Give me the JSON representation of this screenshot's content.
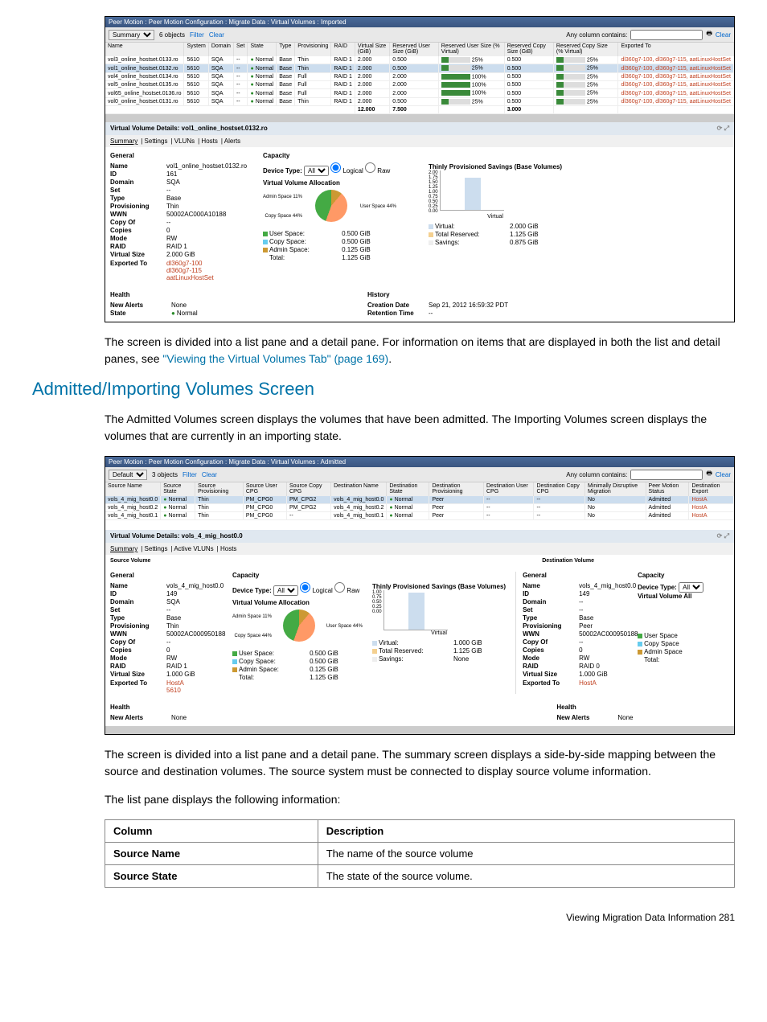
{
  "sshot1": {
    "title": "Peer Motion : Peer Motion Configuration : Migrate Data : Virtual Volumes : Imported",
    "toolbar": {
      "view": "Summary",
      "count": "6 objects",
      "filter": "Filter",
      "clear": "Clear",
      "anycol": "Any column contains:",
      "clear2": "Clear"
    },
    "headers": [
      "Name",
      "System",
      "Domain",
      "Set",
      "State",
      "Type",
      "Provisioning",
      "RAID",
      "Virtual Size (GiB)",
      "Reserved User Size (GiB)",
      "Reserved User Size (% Virtual)",
      "Reserved Copy Size (GiB)",
      "Reserved Copy Size (% Virtual)",
      "Exported To"
    ],
    "rows": [
      {
        "name": "vol3_online_hostset.0133.ro",
        "sys": "5610",
        "dom": "SQA",
        "set": "--",
        "state": "Normal",
        "type": "Base",
        "prov": "Thin",
        "raid": "RAID 1",
        "vsz": "2.000",
        "rusz": "0.500",
        "rupct": "25%",
        "rcsz": "0.500",
        "rcpct": "25%",
        "exp": "dl360g7-100, dl360g7-115, aatLinuxHostSet"
      },
      {
        "name": "vol1_online_hostset.0132.ro",
        "sys": "5610",
        "dom": "SQA",
        "set": "--",
        "state": "Normal",
        "type": "Base",
        "prov": "Thin",
        "raid": "RAID 1",
        "vsz": "2.000",
        "rusz": "0.500",
        "rupct": "25%",
        "rcsz": "0.500",
        "rcpct": "25%",
        "exp": "dl360g7-100, dl360g7-115, aatLinuxHostSet",
        "sel": true
      },
      {
        "name": "vol4_online_hostset.0134.ro",
        "sys": "5610",
        "dom": "SQA",
        "set": "--",
        "state": "Normal",
        "type": "Base",
        "prov": "Full",
        "raid": "RAID 1",
        "vsz": "2.000",
        "rusz": "2.000",
        "rupct": "100%",
        "rcsz": "0.500",
        "rcpct": "25%",
        "exp": "dl360g7-100, dl360g7-115, aatLinuxHostSet"
      },
      {
        "name": "vol5_online_hostset.0135.ro",
        "sys": "5610",
        "dom": "SQA",
        "set": "--",
        "state": "Normal",
        "type": "Base",
        "prov": "Full",
        "raid": "RAID 1",
        "vsz": "2.000",
        "rusz": "2.000",
        "rupct": "100%",
        "rcsz": "0.500",
        "rcpct": "25%",
        "exp": "dl360g7-100, dl360g7-115, aatLinuxHostSet"
      },
      {
        "name": "vol65_online_hostset.0136.ro",
        "sys": "5610",
        "dom": "SQA",
        "set": "--",
        "state": "Normal",
        "type": "Base",
        "prov": "Full",
        "raid": "RAID 1",
        "vsz": "2.000",
        "rusz": "2.000",
        "rupct": "100%",
        "rcsz": "0.500",
        "rcpct": "25%",
        "exp": "dl360g7-100, dl360g7-115, aatLinuxHostSet"
      },
      {
        "name": "vol0_online_hostset.0131.ro",
        "sys": "5610",
        "dom": "SQA",
        "set": "--",
        "state": "Normal",
        "type": "Base",
        "prov": "Thin",
        "raid": "RAID 1",
        "vsz": "2.000",
        "rusz": "0.500",
        "rupct": "25%",
        "rcsz": "0.500",
        "rcpct": "25%",
        "exp": "dl360g7-100, dl360g7-115, aatLinuxHostSet"
      }
    ],
    "totals": {
      "vsz": "12.000",
      "rusz": "7.500",
      "rcsz": "3.000"
    },
    "detail_title": "Virtual Volume Details: vol1_online_hostset.0132.ro",
    "tabs": [
      "Summary",
      "Settings",
      "VLUNs",
      "Hosts",
      "Alerts"
    ],
    "general": "General",
    "capacity": "Capacity",
    "props": {
      "Name": "vol1_online_hostset.0132.ro",
      "ID": "161",
      "Domain": "SQA",
      "Set": "--",
      "Type": "Base",
      "Provisioning": "Thin",
      "WWN": "50002AC000A10188",
      "Copy Of": "--",
      "Copies": "0",
      "Mode": "RW",
      "RAID": "RAID 1",
      "Virtual Size": "2.000 GiB"
    },
    "exported_label": "Exported To",
    "exported": [
      "dl360g7-100",
      "dl360g7-115",
      "aatLinuxHostSet"
    ],
    "devtype": "Device Type:",
    "all": "All",
    "logical": "Logical",
    "raw": "Raw",
    "vva": "Virtual Volume Allocation",
    "pie_labels": {
      "admin": "Admin Space 11%",
      "user": "User Space 44%",
      "copy": "Copy Space 44%"
    },
    "legend1": [
      [
        "User Space:",
        "0.500 GiB"
      ],
      [
        "Copy Space:",
        "0.500 GiB"
      ],
      [
        "Admin Space:",
        "0.125 GiB"
      ],
      [
        "Total:",
        "1.125 GiB"
      ]
    ],
    "tp": "Thinly Provisioned Savings (Base Volumes)",
    "yticks": [
      "2.00",
      "1.75",
      "1.50",
      "1.25",
      "1.00",
      "0.75",
      "0.50",
      "0.25",
      "0.00"
    ],
    "xcat": "Virtual",
    "legend2": [
      [
        "Virtual:",
        "2.000 GiB"
      ],
      [
        "Total Reserved:",
        "1.125 GiB"
      ],
      [
        "Savings:",
        "0.875 GiB"
      ]
    ],
    "health": "Health",
    "history": "History",
    "alerts": {
      "New Alerts": "None",
      "State": "Normal"
    },
    "hist": {
      "Creation Date": "Sep 21, 2012 16:59:32 PDT",
      "Retention Time": "--"
    }
  },
  "body1_a": "The screen is divided into a list pane and a detail pane. For information on items that are displayed in both the list and detail panes, see ",
  "body1_link": "\"Viewing the Virtual Volumes Tab\" (page 169)",
  "body1_b": ".",
  "h2": "Admitted/Importing Volumes Screen",
  "body2": "The Admitted Volumes screen displays the volumes that have been admitted. The Importing Volumes screen displays the volumes that are currently in an importing state.",
  "sshot2": {
    "title": "Peer Motion : Peer Motion Configuration : Migrate Data : Virtual Volumes : Admitted",
    "toolbar": {
      "view": "Default",
      "count": "3 objects",
      "filter": "Filter",
      "clear": "Clear",
      "anycol": "Any column contains:",
      "clear2": "Clear"
    },
    "headers": [
      "Source Name",
      "Source State",
      "Source Provisioning",
      "Source User CPG",
      "Source Copy CPG",
      "Destination Name",
      "Destination State",
      "Destination Provisioning",
      "Destination User CPG",
      "Destination Copy CPG",
      "Minimally Disruptive Migration",
      "Peer Motion Status",
      "Destination Export"
    ],
    "rows": [
      {
        "sn": "vols_4_mig_host0.0",
        "ss": "Normal",
        "sp": "Thin",
        "suc": "PM_CPG0",
        "scc": "PM_CPG2",
        "dn": "vols_4_mig_host0.0",
        "ds": "Normal",
        "dp": "Peer",
        "duc": "--",
        "dcc": "--",
        "mdm": "No",
        "pms": "Admitted",
        "de": "HostA",
        "sel": true
      },
      {
        "sn": "vols_4_mig_host0.2",
        "ss": "Normal",
        "sp": "Thin",
        "suc": "PM_CPG0",
        "scc": "PM_CPG2",
        "dn": "vols_4_mig_host0.2",
        "ds": "Normal",
        "dp": "Peer",
        "duc": "--",
        "dcc": "--",
        "mdm": "No",
        "pms": "Admitted",
        "de": "HostA"
      },
      {
        "sn": "vols_4_mig_host0.1",
        "ss": "Normal",
        "sp": "Thin",
        "suc": "PM_CPG0",
        "scc": "--",
        "dn": "vols_4_mig_host0.1",
        "ds": "Normal",
        "dp": "Peer",
        "duc": "--",
        "dcc": "--",
        "mdm": "No",
        "pms": "Admitted",
        "de": "HostA"
      }
    ],
    "detail_title": "Virtual Volume Details: vols_4_mig_host0.0",
    "tabs": [
      "Summary",
      "Settings",
      "Active VLUNs",
      "Hosts"
    ],
    "srcvol": "Source Volume",
    "dstvol": "Destination Volume",
    "general": "General",
    "capacity": "Capacity",
    "src_props": {
      "Name": "vols_4_mig_host0.0",
      "ID": "149",
      "Domain": "SQA",
      "Set": "--",
      "Type": "Base",
      "Provisioning": "Thin",
      "WWN": "50002AC000950188",
      "Copy Of": "--",
      "Copies": "0",
      "Mode": "RW",
      "RAID": "RAID 1",
      "Virtual Size": "1.000 GiB"
    },
    "src_exp_label": "Exported To",
    "src_exp": [
      "HostA",
      "5610"
    ],
    "devtype": "Device Type:",
    "all": "All",
    "logical": "Logical",
    "raw": "Raw",
    "vva": "Virtual Volume Allocation",
    "pie_labels": {
      "admin": "Admin Space 11%",
      "user": "User Space 44%",
      "copy": "Copy Space 44%"
    },
    "legend1": [
      [
        "User Space:",
        "0.500 GiB"
      ],
      [
        "Copy Space:",
        "0.500 GiB"
      ],
      [
        "Admin Space:",
        "0.125 GiB"
      ],
      [
        "Total:",
        "1.125 GiB"
      ]
    ],
    "tp": "Thinly Provisioned Savings (Base Volumes)",
    "yticks": [
      "1.00",
      "0.75",
      "0.50",
      "0.25",
      "0.00"
    ],
    "xcat": "Virtual",
    "legend2": [
      [
        "Virtual:",
        "1.000 GiB"
      ],
      [
        "Total Reserved:",
        "1.125 GiB"
      ],
      [
        "Savings:",
        "None"
      ]
    ],
    "dst_props": {
      "Name": "vols_4_mig_host0.0",
      "ID": "149",
      "Domain": "--",
      "Set": "--",
      "Type": "Base",
      "Provisioning": "Peer",
      "WWN": "50002AC000950188",
      "Copy Of": "--",
      "Copies": "0",
      "Mode": "RW",
      "RAID": "RAID 0",
      "Virtual Size": "1.000 GiB"
    },
    "dst_exp_label": "Exported To",
    "dst_exp": [
      "HostA"
    ],
    "dst_devtype": "Device Type:",
    "dst_all": "All",
    "dst_vva": "Virtual Volume All",
    "dst_legend": [
      [
        "User Space",
        ""
      ],
      [
        "Copy Space",
        ""
      ],
      [
        "Admin Space",
        ""
      ],
      [
        "Total:",
        ""
      ]
    ],
    "health": "Health",
    "alerts": {
      "New Alerts": "None"
    },
    "dst_alerts": {
      "New Alerts": "None"
    }
  },
  "body3": "The screen is divided into a list pane and a detail pane. The summary screen displays a side-by-side mapping between the source and destination volumes. The source system must be connected to display source volume information.",
  "body4": "The list pane displays the following information:",
  "table": {
    "h1": "Column",
    "h2": "Description",
    "rows": [
      [
        "Source Name",
        "The name of the source volume"
      ],
      [
        "Source State",
        "The state of the source volume."
      ]
    ]
  },
  "footer": "Viewing Migration Data Information   281"
}
